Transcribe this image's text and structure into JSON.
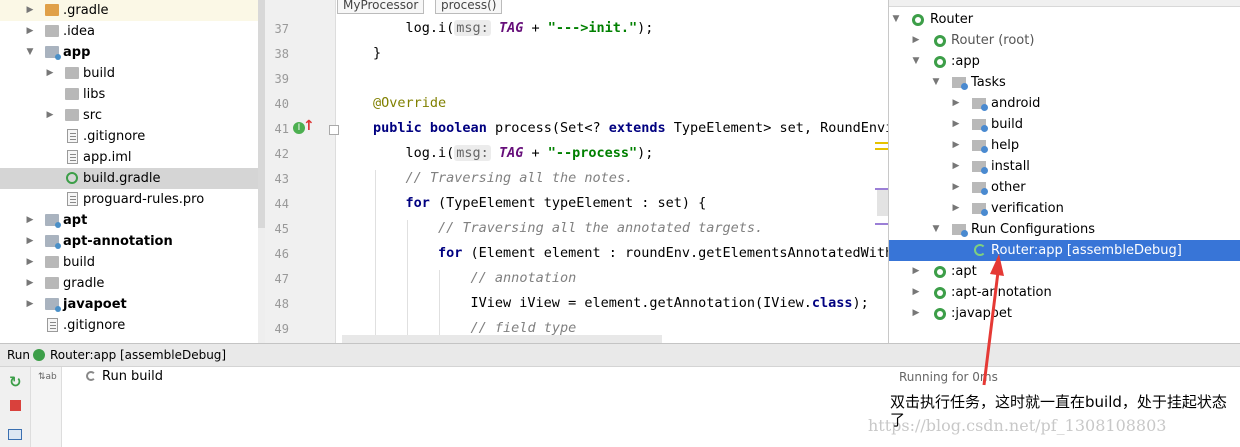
{
  "project_tree": {
    "items": [
      {
        "label": ".gradle",
        "bold": false
      },
      {
        "label": ".idea",
        "bold": false
      },
      {
        "label": "app",
        "bold": true
      },
      {
        "label": "build",
        "bold": false
      },
      {
        "label": "libs",
        "bold": false
      },
      {
        "label": "src",
        "bold": false
      },
      {
        "label": ".gitignore",
        "bold": false
      },
      {
        "label": "app.iml",
        "bold": false
      },
      {
        "label": "build.gradle",
        "bold": false
      },
      {
        "label": "proguard-rules.pro",
        "bold": false
      },
      {
        "label": "apt",
        "bold": true
      },
      {
        "label": "apt-annotation",
        "bold": true
      },
      {
        "label": "build",
        "bold": false
      },
      {
        "label": "gradle",
        "bold": false
      },
      {
        "label": "javapoet",
        "bold": true
      },
      {
        "label": ".gitignore",
        "bold": false
      }
    ]
  },
  "editor": {
    "breadcrumbs": [
      "MyProcessor",
      "process()"
    ],
    "line_numbers": [
      "37",
      "38",
      "39",
      "40",
      "41",
      "42",
      "43",
      "44",
      "45",
      "46",
      "47",
      "48",
      "49"
    ],
    "lines": [
      {
        "p": [
          "    log.i(",
          "msg:",
          " ",
          "TAG",
          " + ",
          "\"--->init.\"",
          ");"
        ]
      },
      {
        "p": [
          "}"
        ]
      },
      {
        "p": [
          ""
        ]
      },
      {
        "p": [
          "@Override"
        ]
      },
      {
        "p": [
          "public",
          " ",
          "boolean",
          " process(Set<? ",
          "extends",
          " TypeElement> set, RoundEnvironment roundEnv) {"
        ]
      },
      {
        "p": [
          "    log.i(",
          "msg:",
          " ",
          "TAG",
          " + ",
          "\"--process\"",
          ");"
        ]
      },
      {
        "p": [
          "    ",
          "// Traversing all the notes."
        ]
      },
      {
        "p": [
          "    ",
          "for",
          " (TypeElement typeElement : set) {"
        ]
      },
      {
        "p": [
          "        ",
          "// Traversing all the annotated targets."
        ]
      },
      {
        "p": [
          "        ",
          "for",
          " (Element element : roundEnv.getElementsAnnotatedWith(typeElement)) {"
        ]
      },
      {
        "p": [
          "            ",
          "// annotation"
        ]
      },
      {
        "p": [
          "            IView iView = element.getAnnotation(IView.",
          "class",
          ");"
        ]
      },
      {
        "p": [
          "            ",
          "// field type"
        ]
      }
    ]
  },
  "gradle_panel": {
    "items": [
      {
        "label": "Router"
      },
      {
        "label": "Router (root)"
      },
      {
        "label": ":app"
      },
      {
        "label": "Tasks"
      },
      {
        "label": "android"
      },
      {
        "label": "build"
      },
      {
        "label": "help"
      },
      {
        "label": "install"
      },
      {
        "label": "other"
      },
      {
        "label": "verification"
      },
      {
        "label": "Run Configurations"
      },
      {
        "label": "Router:app [assembleDebug]"
      },
      {
        "label": ":apt"
      },
      {
        "label": ":apt-annotation"
      },
      {
        "label": ":javapoet"
      }
    ]
  },
  "run_bar": {
    "prefix": "Run",
    "config": "Router:app [assembleDebug]"
  },
  "run_panel": {
    "tree_item": "Run build",
    "status": "Running for 0ms"
  },
  "annotation": {
    "text": "双击执行任务，这时就一直在build，处于挂起状态了",
    "color": "#e53935"
  },
  "watermark": "https://blog.csdn.net/pf_1308108803"
}
